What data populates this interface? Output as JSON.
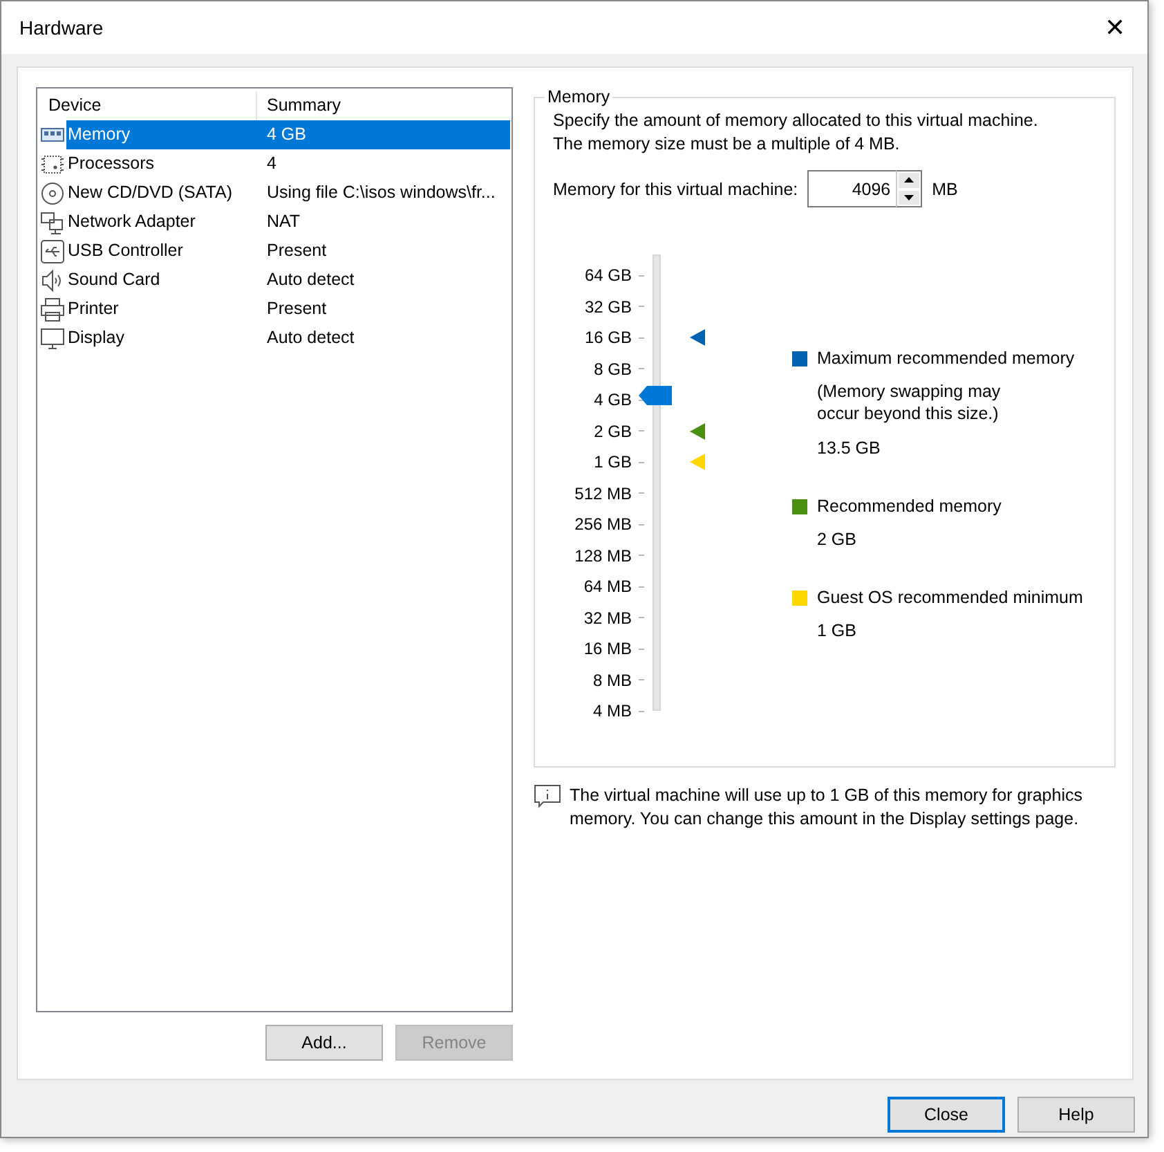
{
  "window": {
    "title": "Hardware",
    "close_glyph": "✕"
  },
  "devices": {
    "columns": [
      "Device",
      "Summary"
    ],
    "rows": [
      {
        "kind": "memory",
        "device": "Memory",
        "summary": "4 GB",
        "selected": true
      },
      {
        "kind": "cpu",
        "device": "Processors",
        "summary": "4",
        "selected": false
      },
      {
        "kind": "disc",
        "device": "New CD/DVD (SATA)",
        "summary": "Using file C:\\isos windows\\fr...",
        "selected": false
      },
      {
        "kind": "network",
        "device": "Network Adapter",
        "summary": "NAT",
        "selected": false
      },
      {
        "kind": "usb",
        "device": "USB Controller",
        "summary": "Present",
        "selected": false
      },
      {
        "kind": "sound",
        "device": "Sound Card",
        "summary": "Auto detect",
        "selected": false
      },
      {
        "kind": "printer",
        "device": "Printer",
        "summary": "Present",
        "selected": false
      },
      {
        "kind": "display",
        "device": "Display",
        "summary": "Auto detect",
        "selected": false
      }
    ]
  },
  "list_buttons": [
    {
      "label": "Add...",
      "disabled": false
    },
    {
      "label": "Remove",
      "disabled": true
    }
  ],
  "memory": {
    "group_title": "Memory",
    "description": "Specify the amount of memory allocated to this virtual machine. The memory size must be a multiple of 4 MB.",
    "field_label": "Memory for this virtual machine:",
    "value": "4096",
    "unit": "MB",
    "ticks": [
      {
        "label": "64 GB"
      },
      {
        "label": "32 GB"
      },
      {
        "label": "16 GB",
        "marker": {
          "color": "#0063b1"
        }
      },
      {
        "label": "8 GB"
      },
      {
        "label": "4 GB"
      },
      {
        "label": "2 GB",
        "marker": {
          "color": "#4a8f12"
        }
      },
      {
        "label": "1 GB",
        "marker": {
          "color": "#ffd700"
        }
      },
      {
        "label": "512 MB"
      },
      {
        "label": "256 MB"
      },
      {
        "label": "128 MB"
      },
      {
        "label": "64 MB"
      },
      {
        "label": "32 MB"
      },
      {
        "label": "16 MB"
      },
      {
        "label": "8 MB"
      },
      {
        "label": "4 MB"
      }
    ],
    "slider": {
      "level": 0.714
    },
    "legend": [
      {
        "label": "Maximum recommended memory",
        "note": "(Memory swapping may occur beyond this size.)",
        "value": "13.5 GB",
        "color": "#0063b1"
      },
      {
        "label": "Recommended memory",
        "value": "2 GB",
        "color": "#4a8f12"
      },
      {
        "label": "Guest OS recommended minimum",
        "value": "1 GB",
        "color": "#ffd700"
      }
    ]
  },
  "info": "The virtual machine will use up to 1 GB of this memory for graphics memory. You can change this amount in the Display settings page.",
  "dialog_buttons": [
    {
      "label": "Close",
      "default": true
    },
    {
      "label": "Help",
      "default": false
    }
  ]
}
